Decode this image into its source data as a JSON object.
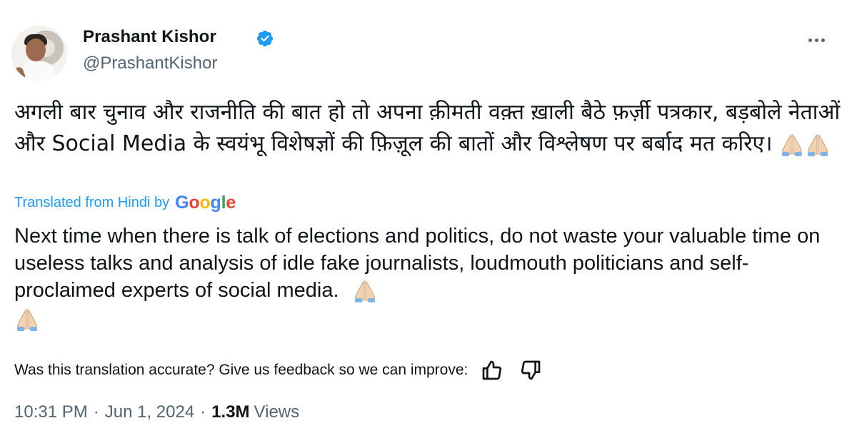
{
  "tweet": {
    "author_name": "Prashant Kishor",
    "author_handle": "@PrashantKishor",
    "body_hindi": "अगली बार चुनाव और राजनीति की बात हो तो अपना क़ीमती वक़्त ख़ाली बैठे फ़र्ज़ी पत्रकार, बड़बोले नेताओं और Social Media के स्वयंभू विशेषज्ञों की फ़िज़ूल की बातों और विश्लेषण पर बर्बाद मत करिए।",
    "translated_label": "Translated from Hindi by",
    "translator_brand": "Google",
    "body_english": "Next time when there is talk of elections and politics, do not waste your valuable time on useless talks and analysis of idle fake journalists, loudmouth politicians and self-proclaimed experts of social media.",
    "feedback_prompt": "Was this translation accurate? Give us feedback so we can improve:",
    "time": "10:31 PM",
    "separator": "·",
    "date": "Jun 1, 2024",
    "views_count": "1.3M",
    "views_label": "Views"
  },
  "icons": {
    "verified": "verified-badge-icon",
    "more": "more-options-icon",
    "emoji": "folded-hands-emoji",
    "thumbs_up": "thumbs-up-icon",
    "thumbs_down": "thumbs-down-icon"
  },
  "colors": {
    "accent": "#1d9bf0",
    "text": "#0f1419",
    "secondary": "#536471",
    "google_blue": "#4285f4",
    "google_red": "#ea4335",
    "google_yellow": "#fbbc05",
    "google_green": "#34a853"
  }
}
